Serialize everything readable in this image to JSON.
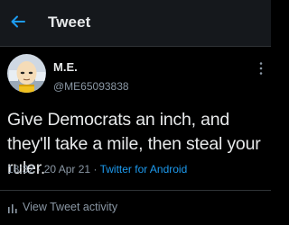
{
  "header": {
    "title": "Tweet",
    "back_icon": "arrow-left-icon",
    "accent_color": "#1d9bf0"
  },
  "tweet": {
    "display_name": "M.E.",
    "handle": "@ME65093838",
    "avatar_icon": "anime-character-avatar",
    "text": "Give Democrats an inch, and they'll take a mile, then steal your ruler.",
    "time": "18:32",
    "date": "20 Apr 21",
    "separator": "·",
    "source": "Twitter for Android",
    "more_icon": "more-vertical-icon"
  },
  "activity": {
    "label": "View Tweet activity",
    "icon": "bar-chart-icon"
  }
}
